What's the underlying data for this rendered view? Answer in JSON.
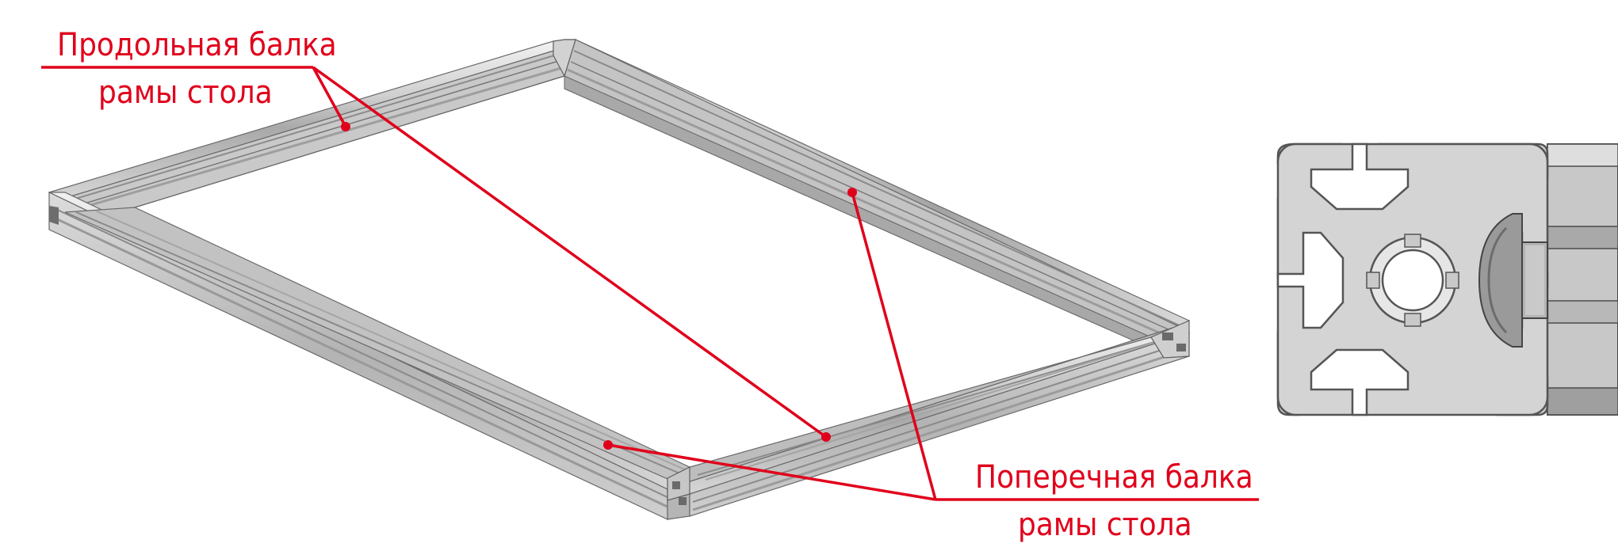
{
  "labels": {
    "longitudinal_line1": "Продольная балка",
    "longitudinal_line2": "рамы стола",
    "transverse_line1": "Поперечная балка",
    "transverse_line2": "рамы стола"
  },
  "colors": {
    "annotation": "#e0001b",
    "aluminum_light": "#dadada",
    "aluminum_mid": "#b9b9b9",
    "aluminum_dark": "#8a8a8a",
    "outline": "#5a5a5a"
  }
}
